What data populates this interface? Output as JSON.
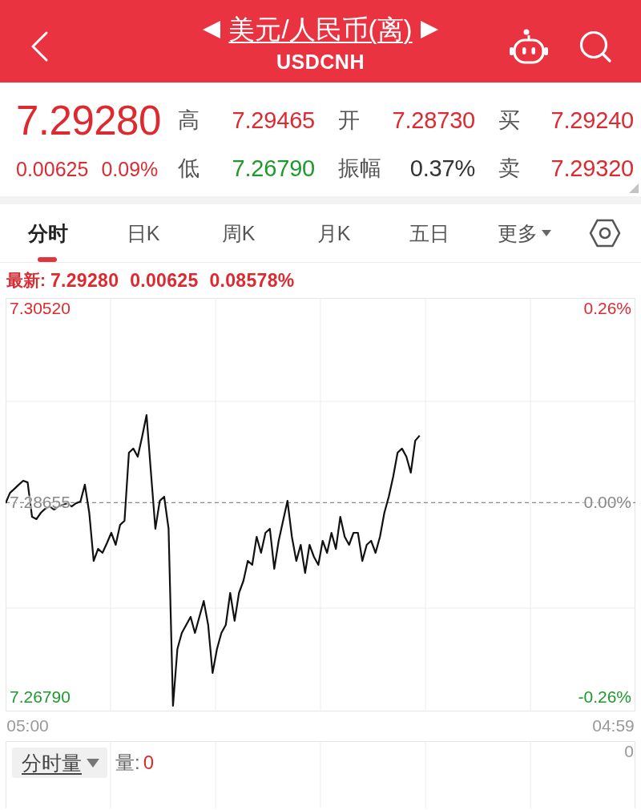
{
  "header": {
    "title": "美元/人民币(离)",
    "subtitle": "USDCNH"
  },
  "quote": {
    "price": "7.29280",
    "change": "0.00625",
    "change_percent": "0.09%",
    "rising": true,
    "stats": [
      {
        "label": "高",
        "value": "7.29465",
        "color": "#dd2a30"
      },
      {
        "label": "开",
        "value": "7.28730",
        "color": "#dd2a30"
      },
      {
        "label": "买",
        "value": "7.29240",
        "color": "#dd2a30"
      },
      {
        "label": "低",
        "value": "7.26790",
        "color": "#1e9a2c"
      },
      {
        "label": "振幅",
        "value": "0.37%",
        "color": "#333333"
      },
      {
        "label": "卖",
        "value": "7.29320",
        "color": "#dd2a30"
      }
    ]
  },
  "tabs": [
    {
      "label": "分时",
      "selected": true,
      "kind": "tab"
    },
    {
      "label": "日K",
      "selected": false,
      "kind": "tab"
    },
    {
      "label": "周K",
      "selected": false,
      "kind": "tab"
    },
    {
      "label": "月K",
      "selected": false,
      "kind": "tab"
    },
    {
      "label": "五日",
      "selected": false,
      "kind": "tab"
    },
    {
      "label": "更多",
      "selected": false,
      "kind": "menu"
    }
  ],
  "latest": {
    "label": "最新:",
    "price": "7.29280",
    "change": "0.00625",
    "change_percent": "0.08578%",
    "rising": true
  },
  "chart": {
    "right_labels": [
      "0.26%",
      "0.00%",
      "-0.26%"
    ],
    "chart_data": {
      "type": "line",
      "categories": [
        null,
        null,
        null,
        null,
        null,
        "05:00",
        null,
        null,
        null,
        null,
        null,
        null,
        null,
        null,
        null,
        null,
        null,
        null,
        null,
        null,
        null,
        null,
        null,
        null,
        null,
        null,
        null,
        null,
        null,
        null,
        null,
        null,
        null,
        null,
        null,
        null,
        null,
        null,
        null,
        null,
        null,
        null,
        null,
        null,
        null,
        null,
        null,
        null,
        null,
        null,
        null,
        null,
        null,
        null,
        null,
        null,
        null,
        null,
        null,
        null,
        null,
        null,
        null,
        null,
        null,
        null,
        null,
        null,
        null,
        null,
        null,
        null,
        null,
        null,
        null,
        null,
        null,
        null,
        null,
        null,
        null,
        null,
        null,
        null,
        null,
        null,
        null,
        null,
        null,
        null,
        null,
        null,
        null,
        null,
        null,
        null,
        null,
        null,
        null,
        null,
        null,
        null,
        null,
        null,
        null,
        null,
        null,
        null,
        null,
        null,
        null,
        null,
        null,
        null,
        null,
        null,
        null,
        null,
        null,
        null,
        null,
        null,
        null,
        null,
        null,
        null,
        null,
        null,
        null,
        null,
        null,
        null,
        null,
        null,
        null,
        null,
        null,
        null,
        "04:59",
        null,
        null,
        null,
        null,
        null
      ],
      "series": [
        {
          "color": "#111111",
          "values": [
            7.2865,
            7.2875,
            7.28788,
            7.28828,
            7.28866,
            7.2885,
            7.28519,
            7.28497,
            7.28558,
            7.28597,
            7.28619,
            7.28589,
            7.28619,
            7.28635,
            7.2865,
            7.28619,
            7.2865,
            7.28666,
            7.28828,
            7.28558,
            7.28096,
            7.28211,
            7.28173,
            7.28266,
            7.28366,
            7.2825,
            7.28442,
            7.28481,
            7.29135,
            7.29174,
            7.29097,
            7.29289,
            7.29497,
            7.28943,
            7.28404,
            7.28673,
            7.28712,
            7.28404,
            7.26705,
            7.2725,
            7.27404,
            7.27481,
            7.27558,
            7.27404,
            7.27558,
            7.27711,
            7.27481,
            7.27019,
            7.2725,
            7.27404,
            7.27481,
            7.27789,
            7.2752,
            7.27789,
            7.27904,
            7.28096,
            7.28058,
            7.28327,
            7.28173,
            7.28366,
            7.28404,
            7.2802,
            7.28289,
            7.28481,
            7.28673,
            7.28327,
            7.28096,
            7.2825,
            7.2798,
            7.2825,
            7.28135,
            7.28058,
            7.28289,
            7.28173,
            7.28366,
            7.28211,
            7.28519,
            7.28327,
            7.2825,
            7.28366,
            7.28366,
            7.28096,
            7.2825,
            7.28289,
            7.28173,
            7.28327,
            7.28558,
            7.28712,
            7.28904,
            7.29135,
            7.29174,
            7.29097,
            7.28943,
            7.2925,
            7.293,
            null,
            null,
            null,
            null,
            null,
            null,
            null,
            null,
            null,
            null,
            null,
            null,
            null,
            null,
            null,
            null,
            null,
            null,
            null,
            null,
            null,
            null,
            null,
            null,
            null,
            null,
            null,
            null,
            null,
            null,
            null,
            null,
            null,
            null,
            null,
            null,
            null,
            null,
            null,
            null,
            null,
            null,
            null,
            null,
            null,
            null,
            null,
            null,
            null
          ]
        }
      ],
      "ylim": [
        7.2665,
        7.3062
      ],
      "yticks": [
        {
          "value": 7.2679,
          "label": "7.26790"
        },
        {
          "value": 7.28655,
          "label": "7.28655"
        },
        {
          "value": 7.3052,
          "label": "7.30520"
        }
      ],
      "ref_lines": [
        {
          "axis": "y",
          "value": 7.28655
        }
      ]
    }
  },
  "volume": {
    "selector": "分时量",
    "label": "量:",
    "value": "0",
    "axis_label": "0"
  }
}
